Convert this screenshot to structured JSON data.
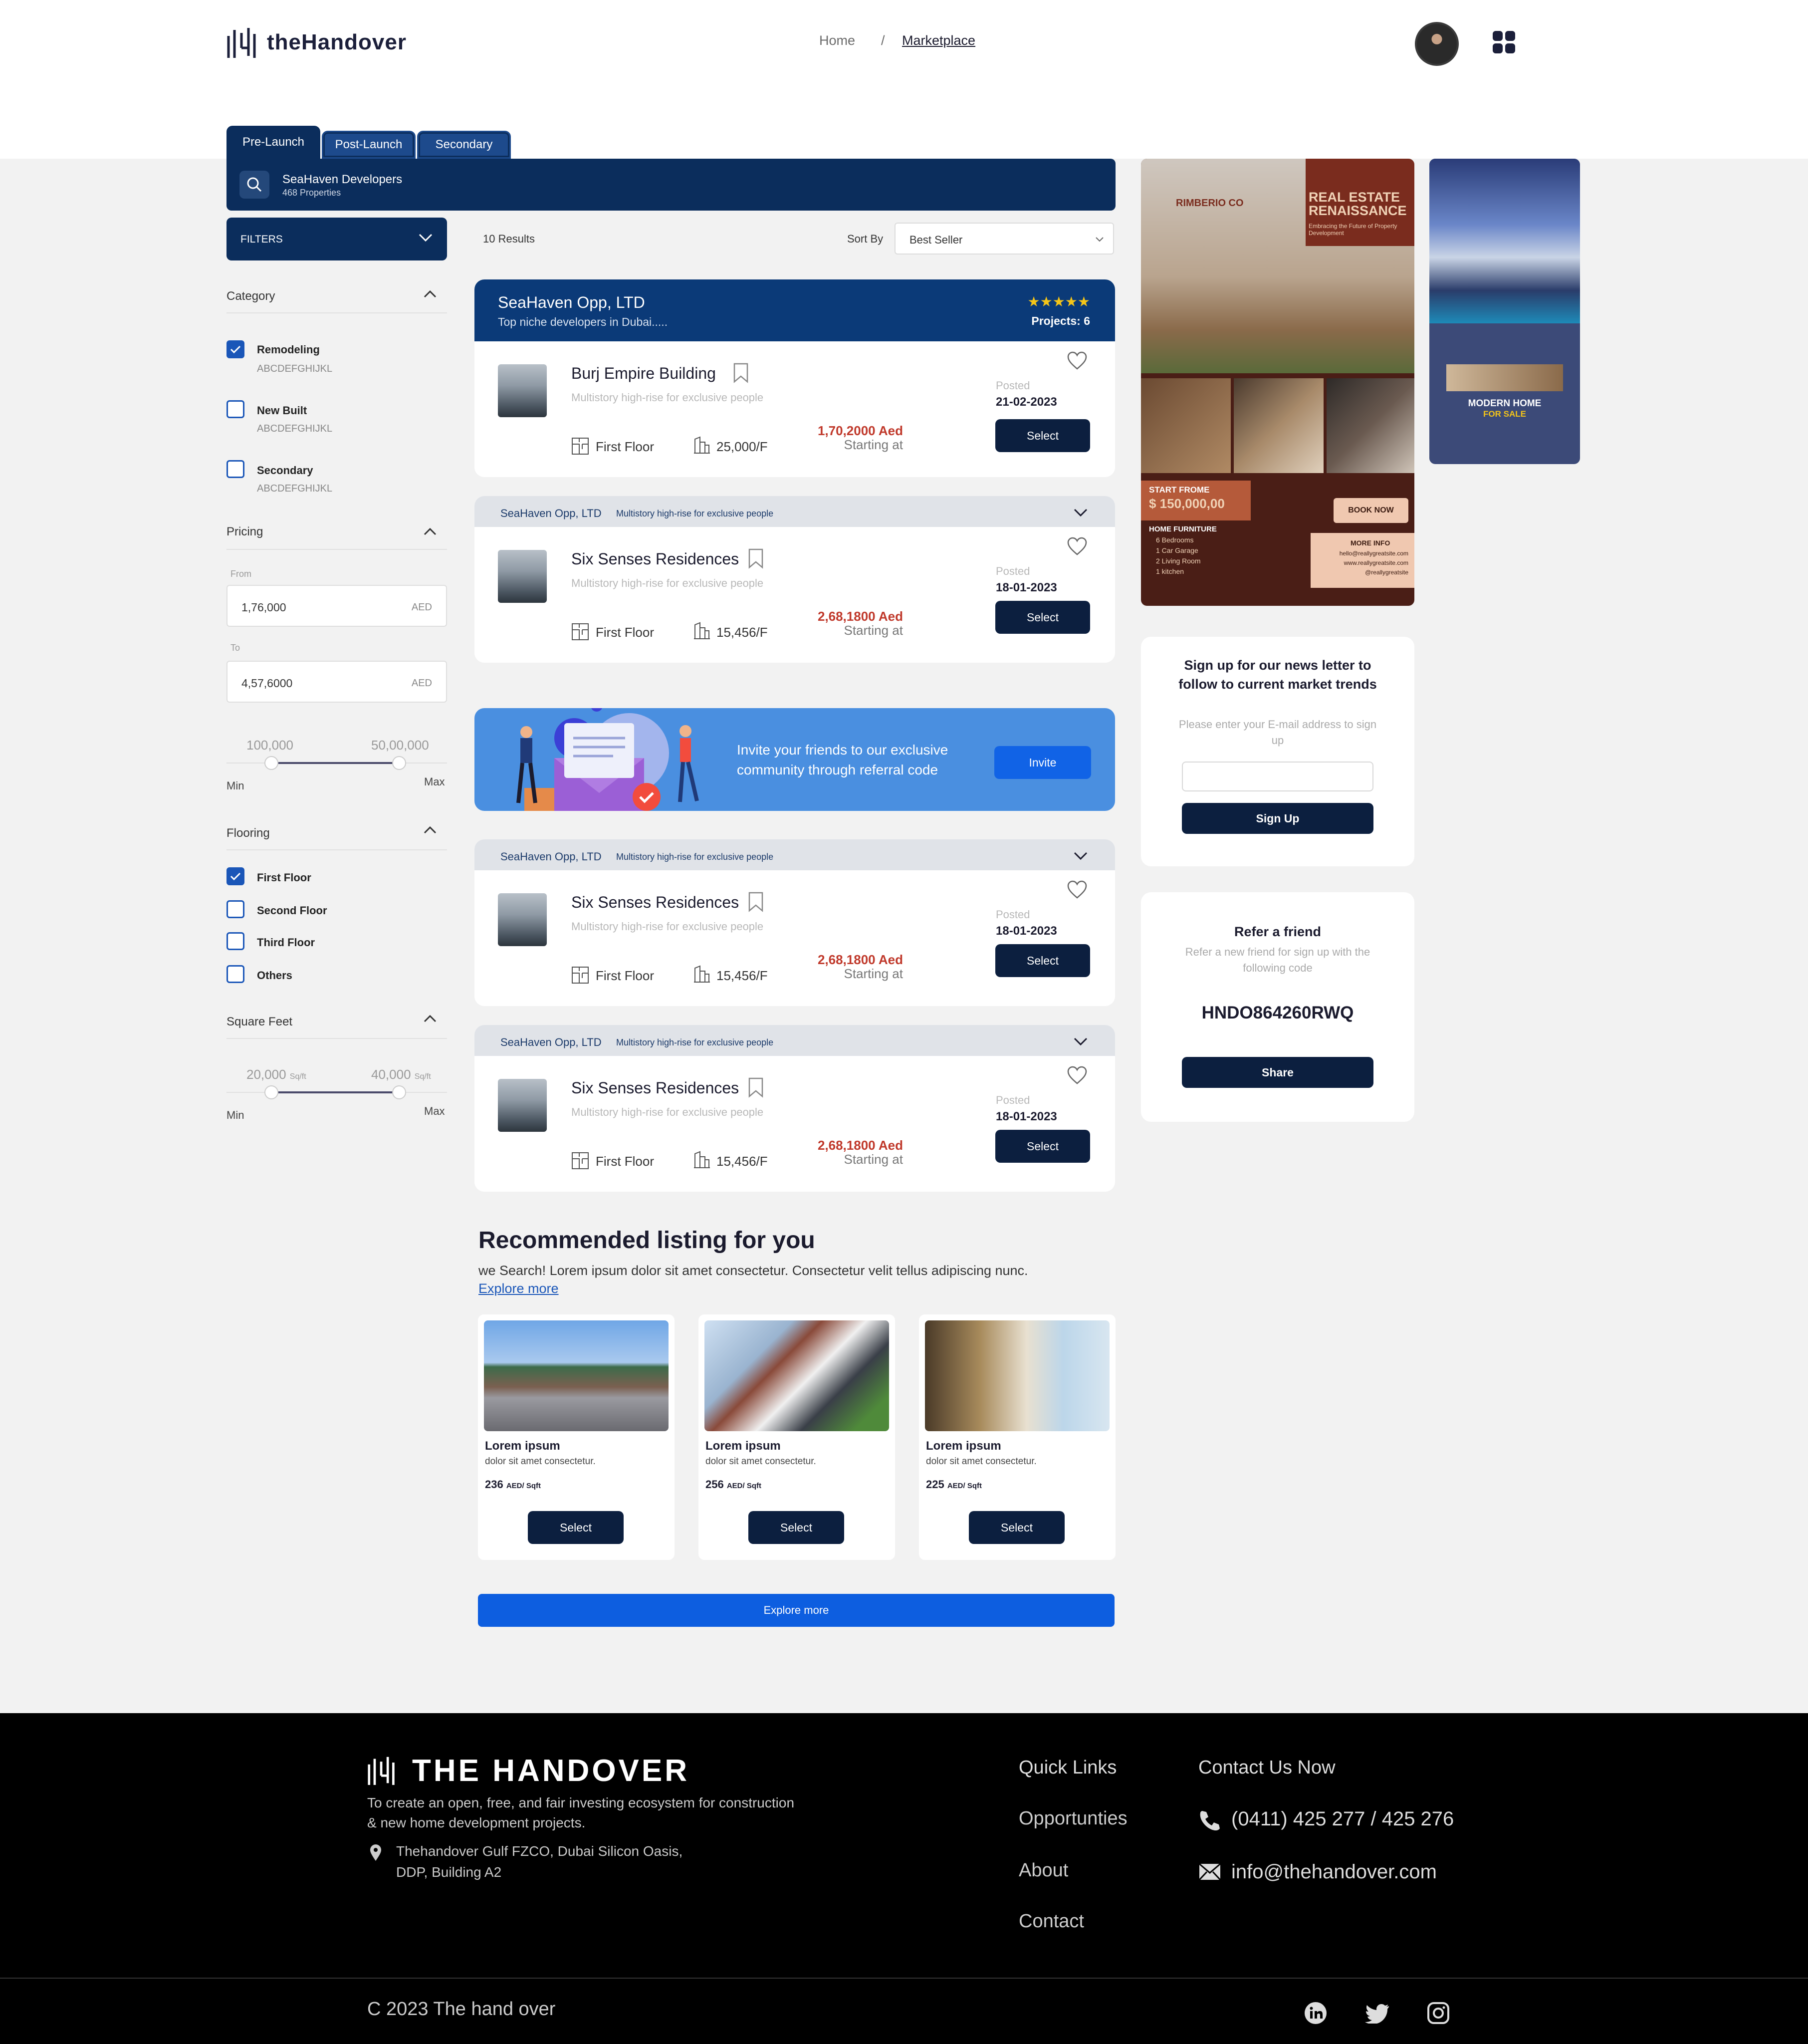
{
  "brand": {
    "name": "theHandover"
  },
  "nav": {
    "home": "Home",
    "sep": "/",
    "marketplace": "Marketplace"
  },
  "tabs": [
    {
      "label": "Pre-Launch"
    },
    {
      "label": "Post-Launch"
    },
    {
      "label": "Secondary"
    }
  ],
  "search": {
    "title": "SeaHaven Developers",
    "subtitle": "468 Properties"
  },
  "filters": {
    "label": "FILTERS",
    "category": {
      "title": "Category",
      "items": [
        {
          "label": "Remodeling",
          "sub": "ABCDEFGHIJKL",
          "checked": true
        },
        {
          "label": "New Built",
          "sub": "ABCDEFGHIJKL",
          "checked": false
        },
        {
          "label": "Secondary",
          "sub": "ABCDEFGHIJKL",
          "checked": false
        }
      ]
    },
    "pricing": {
      "title": "Pricing",
      "from_label": "From",
      "from_value": "1,76,000",
      "to_label": "To",
      "to_value": "4,57,6000",
      "unit": "AED",
      "range_min": "100,000",
      "range_max": "50,00,000",
      "min_label": "Min",
      "max_label": "Max"
    },
    "flooring": {
      "title": "Flooring",
      "items": [
        {
          "label": "First Floor",
          "checked": true
        },
        {
          "label": "Second Floor",
          "checked": false
        },
        {
          "label": "Third Floor",
          "checked": false
        },
        {
          "label": "Others",
          "checked": false
        }
      ]
    },
    "sqft": {
      "title": "Square Feet",
      "range_min": "20,000",
      "range_max": "40,000",
      "unit": "Sq/ft",
      "min_label": "Min",
      "max_label": "Max"
    }
  },
  "results": {
    "count": "10 Results",
    "sort_label": "Sort By",
    "sort_value": "Best Seller"
  },
  "developer": {
    "name": "SeaHaven Opp, LTD",
    "tagline": "Top niche developers in Dubai.....",
    "projects": "Projects: 6",
    "stars": "★★★★★",
    "strip_desc": "Multistory high-rise for exclusive people"
  },
  "listings": [
    {
      "name": "Burj Empire Building",
      "desc": "Multistory high-rise for exclusive people",
      "floor": "First Floor",
      "area": "25,000/F",
      "price": "1,70,2000 Aed",
      "starting": "Starting at",
      "posted": "Posted",
      "date": "21-02-2023",
      "action": "Select"
    },
    {
      "name": "Six Senses Residences",
      "desc": "Multistory high-rise for exclusive people",
      "floor": "First Floor",
      "area": "15,456/F",
      "price": "2,68,1800 Aed",
      "starting": "Starting at",
      "posted": "Posted",
      "date": "18-01-2023",
      "action": "Select"
    },
    {
      "name": "Six Senses Residences",
      "desc": "Multistory high-rise for exclusive people",
      "floor": "First Floor",
      "area": "15,456/F",
      "price": "2,68,1800 Aed",
      "starting": "Starting at",
      "posted": "Posted",
      "date": "18-01-2023",
      "action": "Select"
    },
    {
      "name": "Six Senses Residences",
      "desc": "Multistory high-rise for exclusive people",
      "floor": "First Floor",
      "area": "15,456/F",
      "price": "2,68,1800 Aed",
      "starting": "Starting at",
      "posted": "Posted",
      "date": "18-01-2023",
      "action": "Select"
    }
  ],
  "invite": {
    "text_line1": "Invite your friends to our exclusive",
    "text_line2": "community through referral code",
    "button": "Invite"
  },
  "recommended": {
    "title": "Recommended listing for you",
    "desc": "we Search! Lorem ipsum dolor sit amet consectetur. Consectetur velit tellus adipiscing nunc.",
    "link": "Explore more",
    "items": [
      {
        "name": "Lorem ipsum",
        "sub": "dolor sit amet consectetur.",
        "price": "236",
        "unit": "AED/ Sqft",
        "action": "Select"
      },
      {
        "name": "Lorem ipsum",
        "sub": "dolor sit amet consectetur.",
        "price": "256",
        "unit": "AED/ Sqft",
        "action": "Select"
      },
      {
        "name": "Lorem ipsum",
        "sub": "dolor sit amet consectetur.",
        "price": "225",
        "unit": "AED/ Sqft",
        "action": "Select"
      }
    ],
    "explore_button": "Explore more"
  },
  "ad1": {
    "brand": "RIMBERIO CO",
    "title1": "REAL ESTATE",
    "title2": "RENAISSANCE",
    "tagline": "Embracing the Future of Property Development",
    "start_label": "START FROME",
    "start_price": "$ 150,000,00",
    "book": "BOOK NOW",
    "furniture_title": "HOME FURNITURE",
    "furniture": [
      "6 Bedrooms",
      "1 Car Garage",
      "2 Living Room",
      "1 kitchen"
    ],
    "more_info": "MORE INFO",
    "email": "hello@reallygreatsite.com",
    "site": "www.reallygreatsite.com",
    "handle": "@reallygreatsite"
  },
  "ad2": {
    "title1": "MODERN HOME",
    "title2": "FOR SALE"
  },
  "newsletter": {
    "title": "Sign up for our news letter to follow to current market trends",
    "hint": "Please enter your E-mail address to sign up",
    "button": "Sign Up"
  },
  "refer": {
    "title": "Refer a friend",
    "hint": "Refer a new friend for sign up with the following code",
    "code": "HNDO864260RWQ",
    "button": "Share"
  },
  "footer": {
    "brand": "THE HANDOVER",
    "desc": "To create an open, free, and fair investing ecosystem for construction & new home development projects.",
    "address": "Thehandover Gulf FZCO, Dubai Silicon Oasis, DDP, Building A2",
    "quick_links_title": "Quick Links",
    "links": [
      "Opportunties",
      "About",
      "Contact"
    ],
    "contact_title": "Contact Us Now",
    "phone": "(0411) 425 277 / 425 276",
    "email": "info@thehandover.com",
    "copyright": "C  2023 The hand over"
  },
  "colors": {
    "primary": "#0b2d5c",
    "accent": "#0d5ee0",
    "price": "#c0392b",
    "dark_button": "#0c1f3f"
  }
}
